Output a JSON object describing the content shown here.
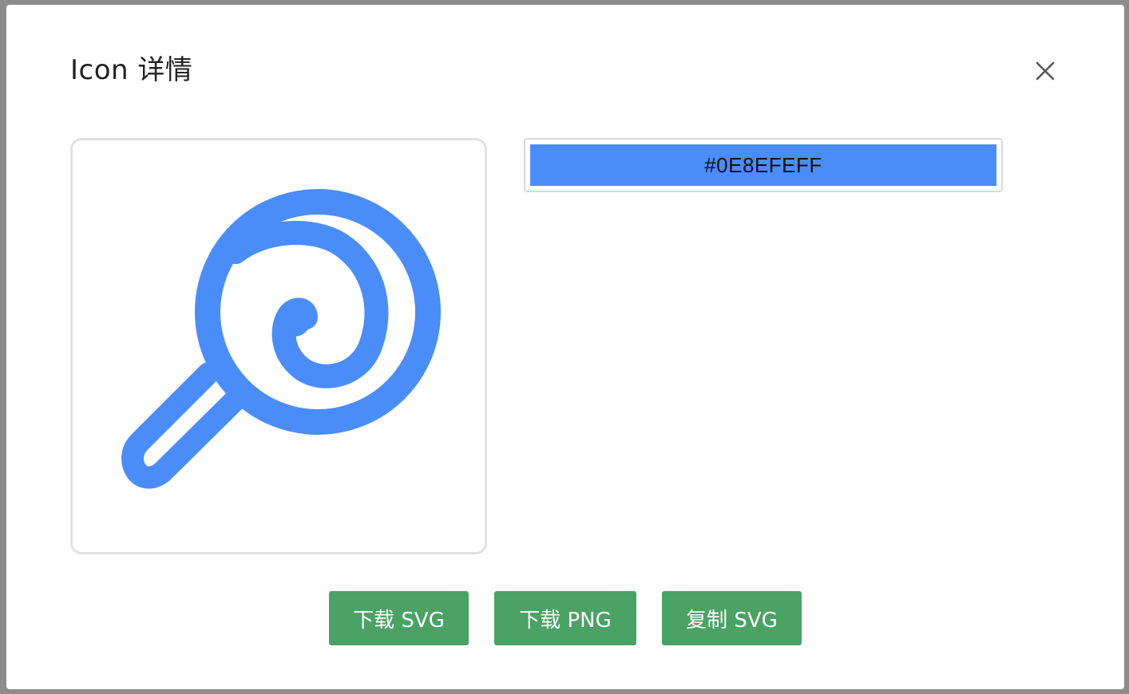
{
  "dialog": {
    "title": "Icon 详情",
    "close_icon": "close-icon"
  },
  "preview": {
    "icon": "lollipop-icon",
    "icon_color": "#4A8DF8"
  },
  "color_input": {
    "value": "#0E8EFEFF",
    "swatch_color": "#4A8DF8"
  },
  "actions": {
    "download_svg": "下载 SVG",
    "download_png": "下载 PNG",
    "copy_svg": "复制 SVG",
    "button_color": "#4AA264"
  }
}
